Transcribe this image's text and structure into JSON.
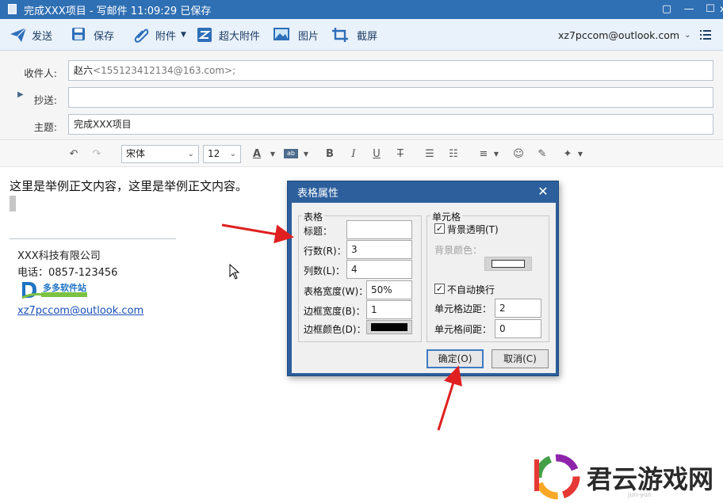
{
  "window": {
    "title": "完成XXX项目 - 写邮件   11:09:29 已保存"
  },
  "toolbar": {
    "send": "发送",
    "save": "保存",
    "attach": "附件",
    "large_attach": "超大附件",
    "image": "图片",
    "screenshot": "截屏",
    "account": "xz7pccom@outlook.com"
  },
  "headers": {
    "to_label": "收件人:",
    "to_name": "赵六",
    "to_addr": "<155123412134@163.com>;",
    "cc_label": "抄送:",
    "cc_value": "",
    "subject_label": "主题:",
    "subject_value": "完成XXX项目"
  },
  "format": {
    "font": "宋体",
    "size": "12"
  },
  "body": {
    "text": "这里是举例正文内容，这里是举例正文内容。",
    "company": "XXX科技有限公司",
    "phone": "电话：0857-123456",
    "logo_text": "多多软件站",
    "email_link": "xz7pccom@outlook.com"
  },
  "dialog": {
    "title": "表格属性",
    "table_group": "表格",
    "caption_label": "标题：",
    "caption_value": "",
    "rows_label": "行数(R)：",
    "rows_value": "3",
    "cols_label": "列数(L)：",
    "cols_value": "4",
    "width_label": "表格宽度(W)：",
    "width_value": "50%",
    "border_width_label": "边框宽度(B)：",
    "border_width_value": "1",
    "border_color_label": "边框颜色(D)：",
    "border_color": "#000000",
    "cell_group": "单元格",
    "bg_transparent_label": "背景透明(T)",
    "bg_transparent_checked": true,
    "bg_color_label": "背景颜色：",
    "bg_color": "#ffffff",
    "no_wrap_label": "不自动换行",
    "no_wrap_checked": true,
    "padding_label": "单元格边距：",
    "padding_value": "2",
    "spacing_label": "单元格间距：",
    "spacing_value": "0",
    "ok": "确定(O)",
    "cancel": "取消(C)"
  },
  "watermark": {
    "text": "君云游戏网",
    "sub": "jun-yun"
  },
  "colors": {
    "titlebar": "#2f6fb3",
    "toolbar": "#e9f1fa",
    "dialog_frame": "#2c5f9c",
    "arrow": "#e02020"
  }
}
